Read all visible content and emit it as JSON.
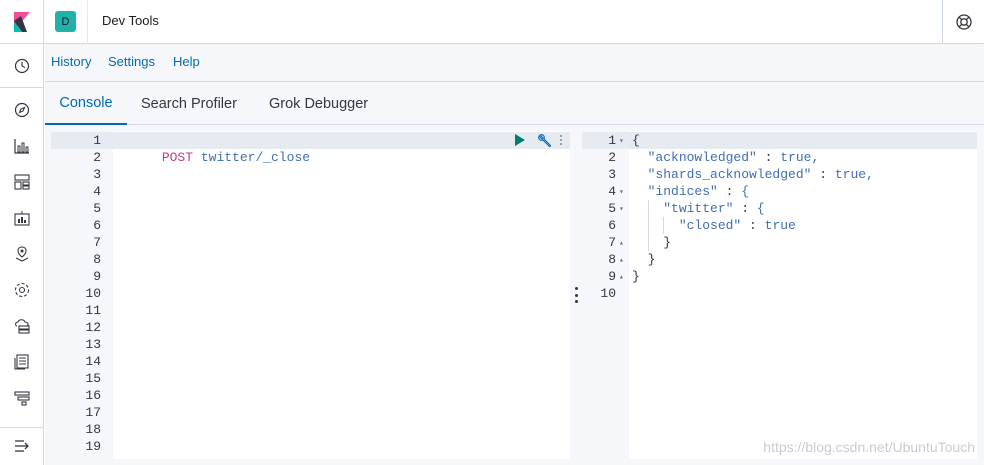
{
  "header": {
    "space_initial": "D",
    "app_title": "Dev Tools",
    "logo_icon": "kibana-logo-icon",
    "help_icon": "help-lifebuoy-icon"
  },
  "sidenav": {
    "items": [
      {
        "icon": "recently-viewed-clock-icon"
      },
      {
        "icon": "discover-compass-icon"
      },
      {
        "icon": "visualize-chart-icon"
      },
      {
        "icon": "dashboard-icon"
      },
      {
        "icon": "canvas-icon"
      },
      {
        "icon": "maps-icon"
      },
      {
        "icon": "machine-learning-icon"
      },
      {
        "icon": "infrastructure-icon"
      },
      {
        "icon": "logs-icon"
      },
      {
        "icon": "apm-icon"
      },
      {
        "icon": "collapse-nav-icon"
      }
    ]
  },
  "topmenu": {
    "history": "History",
    "settings": "Settings",
    "help": "Help"
  },
  "tabs": {
    "console": "Console",
    "search_profiler": "Search Profiler",
    "grok_debugger": "Grok Debugger"
  },
  "request_editor": {
    "method": "POST",
    "path": "twitter/_close",
    "line_numbers": [
      "1",
      "2",
      "3",
      "4",
      "5",
      "6",
      "7",
      "8",
      "9",
      "10",
      "11",
      "12",
      "13",
      "14",
      "15",
      "16",
      "17",
      "18",
      "19"
    ],
    "run_icon": "play-icon",
    "settings_icon": "wrench-icon"
  },
  "response_editor": {
    "line_numbers": [
      "1",
      "2",
      "3",
      "4",
      "5",
      "6",
      "7",
      "8",
      "9",
      "10"
    ],
    "lines": [
      {
        "a": "{",
        "b": "",
        "c": "",
        "d": ""
      },
      {
        "a": "  ",
        "b": "\"acknowledged\"",
        "c": " : ",
        "d": "true,"
      },
      {
        "a": "  ",
        "b": "\"shards_acknowledged\"",
        "c": " : ",
        "d": "true,"
      },
      {
        "a": "  ",
        "b": "\"indices\"",
        "c": " : ",
        "d": "{"
      },
      {
        "a": "    ",
        "b": "\"twitter\"",
        "c": " : ",
        "d": "{"
      },
      {
        "a": "      ",
        "b": "\"closed\"",
        "c": " : ",
        "d": "true"
      },
      {
        "a": "    }",
        "b": "",
        "c": "",
        "d": ""
      },
      {
        "a": "  }",
        "b": "",
        "c": "",
        "d": ""
      },
      {
        "a": "}",
        "b": "",
        "c": "",
        "d": ""
      },
      {
        "a": "",
        "b": "",
        "c": "",
        "d": ""
      }
    ]
  },
  "watermark": "https://blog.csdn.net/UbuntuTouch",
  "colors": {
    "accent": "#006bb4",
    "space_badge": "#20b2aa",
    "run_button": "#017d73"
  }
}
